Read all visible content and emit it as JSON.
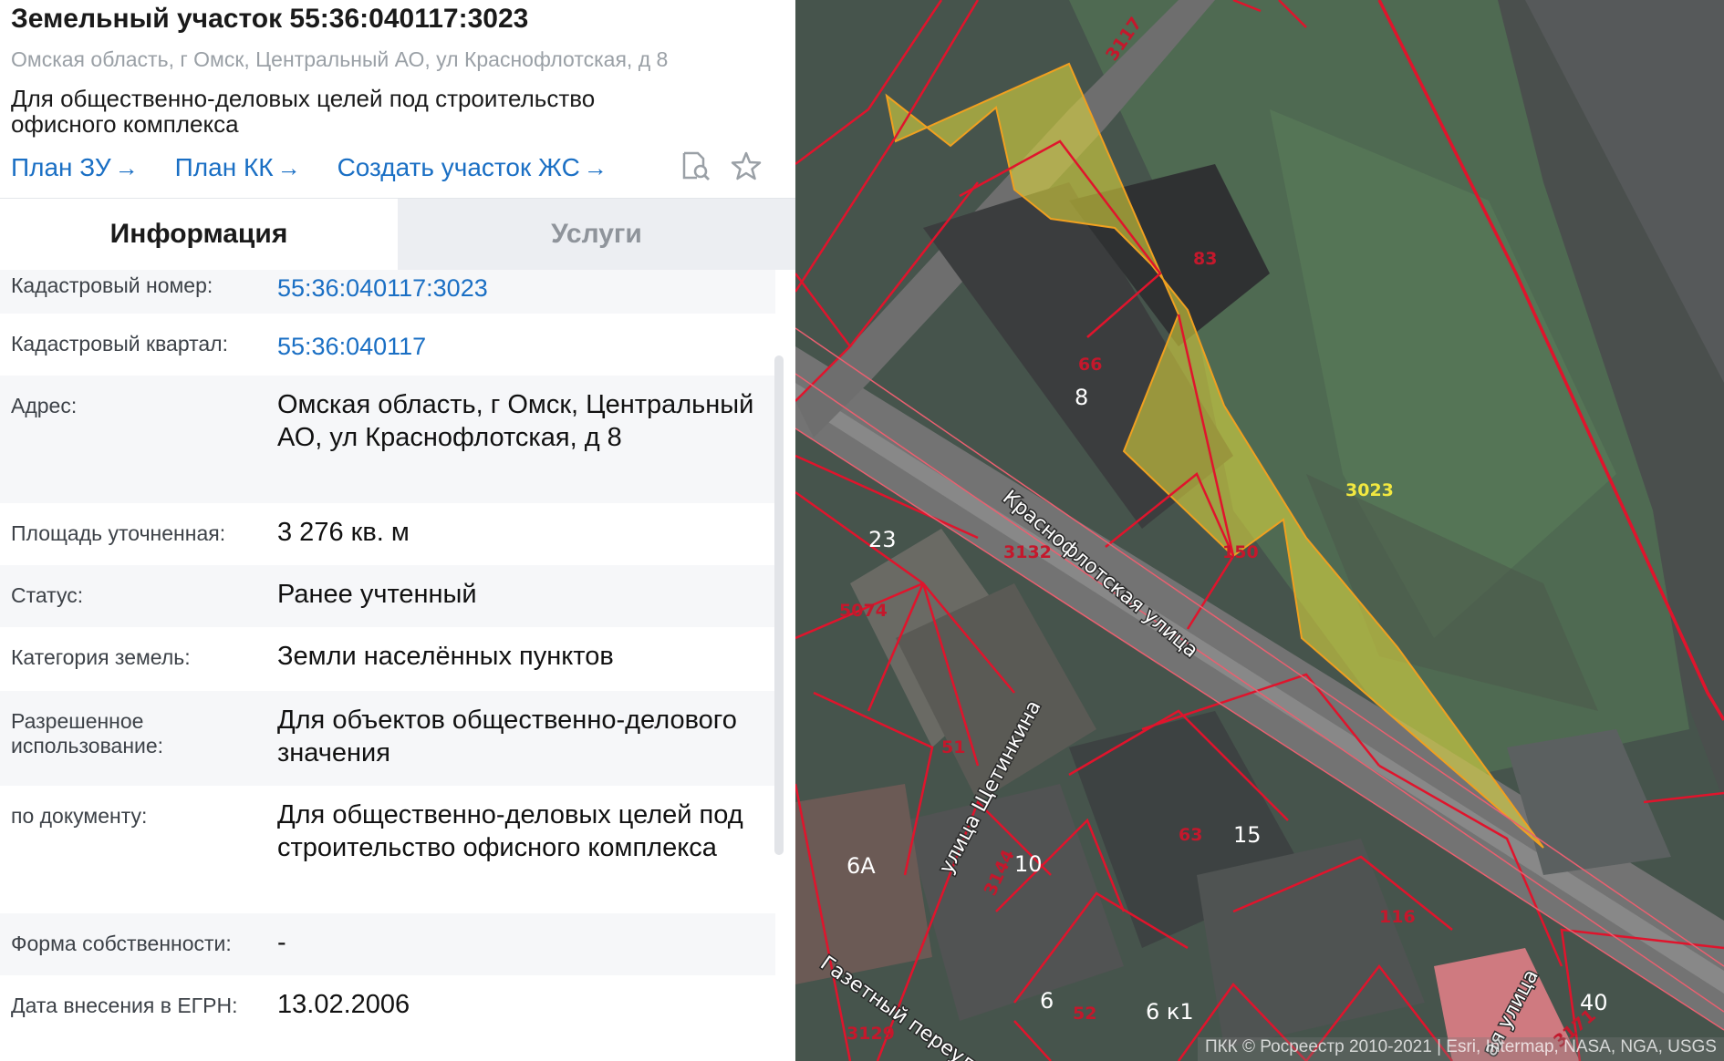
{
  "header": {
    "title": "Земельный участок 55:36:040117:3023",
    "address": "Омская область, г Омск, Центральный АО, ул Краснофлотская, д 8",
    "purpose": "Для общественно-деловых целей под строительство офисного комплекса",
    "links": [
      {
        "label": "План ЗУ",
        "arrow": "→"
      },
      {
        "label": "План КК",
        "arrow": "→"
      },
      {
        "label": "Создать участок ЖС",
        "arrow": "→"
      }
    ],
    "icons": [
      "document-search-icon",
      "star-icon"
    ]
  },
  "tabs": [
    {
      "label": "Информация",
      "active": true
    },
    {
      "label": "Услуги",
      "active": false
    }
  ],
  "rows": [
    {
      "label": "Кадастровый номер:",
      "value": "55:36:040117:3023",
      "is_link": true
    },
    {
      "label": "Кадастровый квартал:",
      "value": "55:36:040117",
      "is_link": true
    },
    {
      "label": "Адрес:",
      "value": "Омская область, г Омск, Центральный АО, ул Краснофлотская, д 8",
      "is_link": false
    },
    {
      "label": "Площадь уточненная:",
      "value": "3 276 кв. м",
      "is_link": false
    },
    {
      "label": "Статус:",
      "value": "Ранее учтенный",
      "is_link": false
    },
    {
      "label": "Категория земель:",
      "value": "Земли населённых пунктов",
      "is_link": false
    },
    {
      "label": "Разрешенное использование:",
      "value": "Для объектов общественно-делового значения",
      "is_link": false
    },
    {
      "label": "по документу:",
      "value": "Для общественно-деловых целей под строительство офисного комплекса",
      "is_link": false
    },
    {
      "label": "Форма собственности:",
      "value": "-",
      "is_link": false
    },
    {
      "label": "Дата внесения в ЕГРН:",
      "value": "13.02.2006",
      "is_link": false
    }
  ],
  "map": {
    "parcel_labels": [
      "3117",
      "83",
      "66",
      "3023",
      "150",
      "3132",
      "5074",
      "51",
      "63",
      "116",
      "3144",
      "52",
      "3129",
      "3171"
    ],
    "building_labels": [
      "8",
      "23",
      "15",
      "10",
      "6А",
      "6",
      "6 к1",
      "40"
    ],
    "street_labels": [
      "Краснофлотская улица",
      "улица Щетинкина",
      "Газетный переулок",
      "ая улица"
    ],
    "attribution": "ПКК © Росреестр 2010-2021 | Esri, Intermap, NASA, NGA, USGS",
    "colors": {
      "parcel_border": "#e0142c",
      "selected_fill": "#e8e03c",
      "selected_label": "#f2e840"
    }
  }
}
